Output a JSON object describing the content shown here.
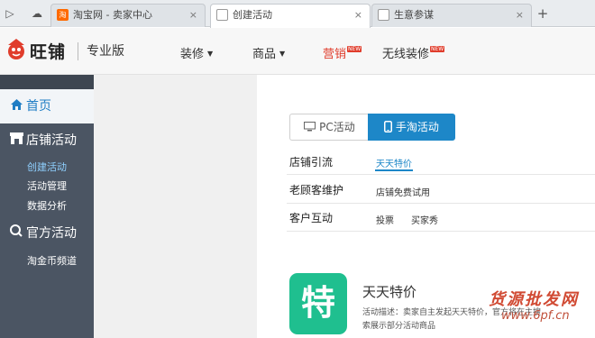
{
  "browser": {
    "tabs": [
      {
        "title": "淘宝网 - 卖家中心",
        "favicon": "taobao-favicon",
        "active": false
      },
      {
        "title": "创建活动",
        "favicon": "page-favicon",
        "active": true
      },
      {
        "title": "生意参谋",
        "favicon": "page-favicon",
        "active": false
      }
    ],
    "taobao_favicon_glyph": "淘",
    "new_tab": "+",
    "close_glyph": "×"
  },
  "header": {
    "brand": "旺铺",
    "edition": "专业版",
    "nav": [
      {
        "label": "装修",
        "caret": "▼"
      },
      {
        "label": "商品",
        "caret": "▼"
      },
      {
        "label": "营销",
        "badge": "NEW"
      },
      {
        "label": "无线装修",
        "badge": "NEW"
      }
    ]
  },
  "sidebar": {
    "home": "首页",
    "sections": [
      {
        "label": "店铺活动",
        "items": [
          "创建活动",
          "活动管理",
          "数据分析"
        ]
      },
      {
        "label": "官方活动",
        "items": [
          "淘金币频道"
        ]
      }
    ]
  },
  "main": {
    "toggle": {
      "pc": "PC活动",
      "mobile": "手淘活动",
      "selected": "mobile"
    },
    "rows": [
      {
        "label": "店铺引流",
        "items": [
          "天天特价"
        ]
      },
      {
        "label": "老顾客维护",
        "items": [
          "店铺免费试用"
        ]
      },
      {
        "label": "客户互动",
        "items": [
          "投票",
          "买家秀"
        ]
      }
    ],
    "promo": {
      "icon_char": "特",
      "title": "天天特价",
      "desc_line1": "活动描述：卖家自主发起天天特价，官方将在主搜",
      "desc_line2": "索展示部分活动商品"
    }
  },
  "watermark": {
    "text": "货源批发网",
    "url": "www.6pf.cn"
  },
  "colors": {
    "accent_blue": "#1d87c8",
    "brand_red": "#e03d2c",
    "sidebar_bg": "#4b5563",
    "promo_green": "#1fbf8f"
  }
}
